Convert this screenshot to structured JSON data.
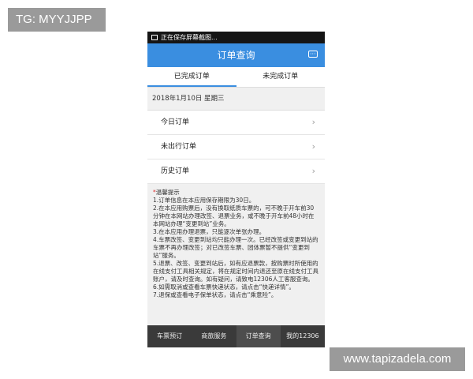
{
  "watermarks": {
    "top_left": "TG: MYYJJPP",
    "bottom_right": "www.tapizadela.com"
  },
  "status_bar": {
    "text": "正在保存屏幕截图..."
  },
  "header": {
    "title": "订单查询",
    "icon": "chat-icon"
  },
  "tabs": [
    {
      "label": "已完成订单",
      "active": true
    },
    {
      "label": "未完成订单",
      "active": false
    }
  ],
  "date_line": "2018年1月10日 星期三",
  "orders": [
    {
      "label": "今日订单"
    },
    {
      "label": "未出行订单"
    },
    {
      "label": "历史订单"
    }
  ],
  "tips": {
    "title": "温馨提示",
    "lines": [
      "1.订单信息在本应用保存期限为30日。",
      "2.在本应用购票后，没有换取纸质车票的，可不晚于开车前30分钟在本网站办理改签、退票业务，或不晚于开车前48小时在本网站办理“变更到站”业务。",
      "3.在本应用办理退票，只能逐次单张办理。",
      "4.车票改签、变更到站均只能办理一次。已经改签或变更到站的车票不再办理改签；对已改签车票、团体票暂不提供“变更到站”服务。",
      "5.退票、改签、变更到站后，如有应退票款，按购票时所使用的在线支付工具相关规定，将在规定时间内退还至原在线支付工具账户，请及时查询。如有疑问，请致电12306人工客服查询。",
      "6.如需取消或查看车票快递状态，请点击“快递详情”。",
      "7.退保或查看电子保单状态，请点击“乘意险”。"
    ]
  },
  "bottom_nav": [
    {
      "label": "车票预订",
      "active": false
    },
    {
      "label": "商旅服务",
      "active": false
    },
    {
      "label": "订单查询",
      "active": true
    },
    {
      "label": "我的12306",
      "active": false
    }
  ],
  "colors": {
    "primary": "#3a8ee0",
    "nav_bg": "#3a3a3a",
    "tip_star": "#d33333"
  }
}
